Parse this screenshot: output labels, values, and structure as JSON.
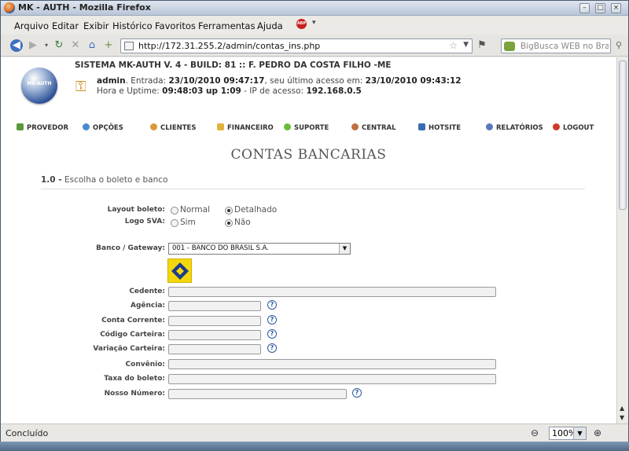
{
  "window": {
    "title": "MK - AUTH - Mozilla Firefox"
  },
  "menu": [
    "Arquivo",
    "Editar",
    "Exibir",
    "Histórico",
    "Favoritos",
    "Ferramentas",
    "Ajuda"
  ],
  "toolbar": {
    "url": "http://172.31.255.2/admin/contas_ins.php",
    "search_placeholder": "BigBusca WEB no Bras"
  },
  "header": {
    "logo_text": "MK-AUTH",
    "system": "SISTEMA MK-AUTH V. 4 - BUILD: 81 :: F. PEDRO DA COSTA FILHO -ME",
    "user": "admin",
    "entry_label": ". Entrada:",
    "entry": "23/10/2010 09:47:17",
    "last_label": ", seu último acesso em:",
    "last": "23/10/2010 09:43:12",
    "uptime_label": "Hora e Uptime:",
    "uptime": "09:48:03 up 1:09",
    "ip_label": "- IP de acesso:",
    "ip": "192.168.0.5"
  },
  "nav": [
    "PROVEDOR",
    "OPÇÕES",
    "CLIENTES",
    "FINANCEIRO",
    "SUPORTE",
    "CENTRAL",
    "HOTSITE",
    "RELATÓRIOS",
    "LOGOUT"
  ],
  "page": {
    "title": "CONTAS BANCARIAS",
    "section_num": "1.0 -",
    "section_text": "Escolha o boleto e banco"
  },
  "form": {
    "layout_label": "Layout boleto:",
    "layout_opt1": "Normal",
    "layout_opt2": "Detalhado",
    "sva_label": "Logo SVA:",
    "sva_opt1": "Sim",
    "sva_opt2": "Não",
    "bank_label": "Banco / Gateway:",
    "bank_selected": "001 - BANCO DO BRASIL S.A.",
    "cedente": "Cedente:",
    "agencia": "Agência:",
    "conta": "Conta Corrente:",
    "cod_carteira": "Código Carteira:",
    "var_carteira": "Variação Carteira:",
    "convenio": "Convênio:",
    "taxa": "Taxa do boleto:",
    "nosso_numero": "Nosso Número:"
  },
  "status": {
    "text": "Concluído",
    "zoom": "100%"
  }
}
